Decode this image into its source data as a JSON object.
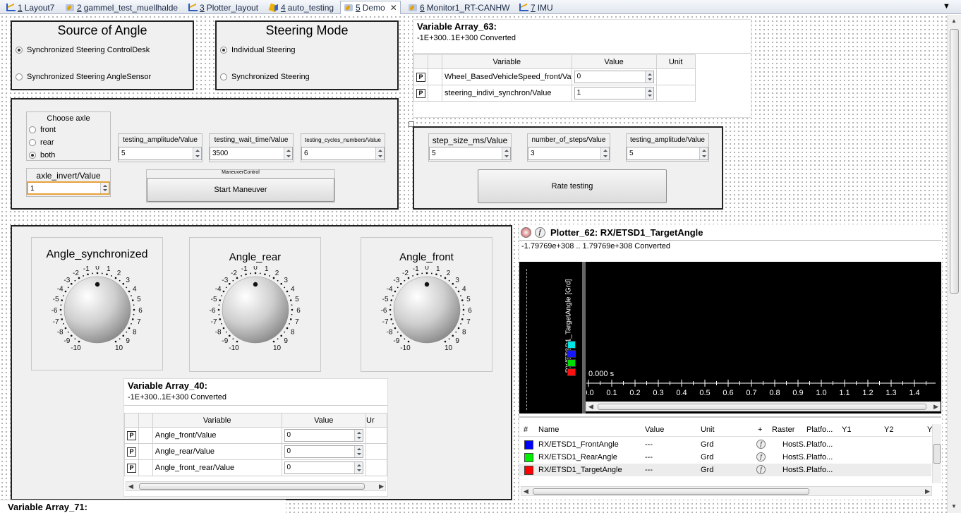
{
  "tabs": [
    {
      "num": "1",
      "label": "Layout7"
    },
    {
      "num": "2",
      "label": "gammel_test_muellhalde"
    },
    {
      "num": "3",
      "label": "Plotter_layout"
    },
    {
      "num": "4",
      "label": "auto_testing"
    },
    {
      "num": "5",
      "label": "Demo"
    },
    {
      "num": "6",
      "label": "Monitor1_RT-CANHW"
    },
    {
      "num": "7",
      "label": "IMU"
    }
  ],
  "source_of_angle": {
    "title": "Source of Angle",
    "options": [
      "Synchronized Steering ControlDesk",
      "Synchronized Steering AngleSensor"
    ],
    "selected": 0
  },
  "steering_mode": {
    "title": "Steering Mode",
    "options": [
      "Individual Steering",
      "Synchronized Steering"
    ],
    "selected": 0
  },
  "maneuver": {
    "choose_axle": {
      "title": "Choose axle",
      "options": [
        "front",
        "rear",
        "both"
      ],
      "selected": 2
    },
    "axle_invert": {
      "label": "axle_invert/Value",
      "value": "1"
    },
    "testing_amplitude": {
      "label": "testing_amplitude/Value",
      "value": "5"
    },
    "testing_wait_time": {
      "label": "testing_wait_time/Value",
      "value": "3500"
    },
    "testing_cycles_numbers": {
      "label": "testing_cycles_numbers/Value",
      "value": "6"
    },
    "group_caption": "ManeuverControl",
    "start_button": "Start Maneuver"
  },
  "rate": {
    "step_size": {
      "label": "step_size_ms/Value",
      "value": "5"
    },
    "number_of_steps": {
      "label": "number_of_steps/Value",
      "value": "3"
    },
    "testing_amplitude": {
      "label": "testing_amplitude/Value",
      "value": "5"
    },
    "button": "Rate testing"
  },
  "var_array_63": {
    "title": "Variable Array_63:",
    "subtitle": "-1E+300..1E+300 Converted",
    "headers": [
      "Variable",
      "Value",
      "Unit"
    ],
    "rows": [
      {
        "flag": "P",
        "variable": "Wheel_BasedVehicleSpeed_front/Va",
        "value": "0",
        "unit": ""
      },
      {
        "flag": "P",
        "variable": "steering_indivi_synchron/Value",
        "value": "1",
        "unit": ""
      }
    ]
  },
  "knobs": [
    {
      "title": "Angle_synchronized",
      "value": 0
    },
    {
      "title": "Angle_rear",
      "value": 0
    },
    {
      "title": "Angle_front",
      "value": 0
    }
  ],
  "knob_ticks": [
    "-10",
    "-9",
    "-8",
    "-7",
    "-6",
    "-5",
    "-4",
    "-3",
    "-2",
    "-1",
    "0",
    "1",
    "2",
    "3",
    "4",
    "5",
    "6",
    "7",
    "8",
    "9",
    "10"
  ],
  "var_array_40": {
    "title": "Variable Array_40:",
    "subtitle": "-1E+300..1E+300 Converted",
    "headers": [
      "Variable",
      "Value",
      "Ur"
    ],
    "rows": [
      {
        "flag": "P",
        "variable": "Angle_front/Value",
        "value": "0"
      },
      {
        "flag": "P",
        "variable": "Angle_rear/Value",
        "value": "0"
      },
      {
        "flag": "P",
        "variable": "Angle_front_rear/Value",
        "value": "0"
      }
    ]
  },
  "var_array_71": {
    "title": "Variable Array_71:"
  },
  "plotter": {
    "title": "Plotter_62:  RX/ETSD1_TargetAngle",
    "subtitle": "-1.79769e+308 .. 1.79769e+308  Converted",
    "y_axis_label": "RX/ETSD1_TargetAngle [Grd]",
    "time_label": "0.000 s",
    "x_ticks": [
      "0.0",
      "0.1",
      "0.2",
      "0.3",
      "0.4",
      "0.5",
      "0.6",
      "0.7",
      "0.8",
      "0.9",
      "1.0",
      "1.1",
      "1.2",
      "1.3",
      "1.4"
    ],
    "swatch_colors": [
      "#00e5e5",
      "#1818ff",
      "#00dd00",
      "#ff1010"
    ],
    "legend_headers": [
      "#",
      "Name",
      "Value",
      "Unit",
      "+",
      "Raster",
      "Platfo...",
      "Y1",
      "Y2",
      "Y"
    ],
    "legend_rows": [
      {
        "color": "#0000ff",
        "name": "RX/ETSD1_FrontAngle",
        "value": "---",
        "unit": "Grd",
        "raster": "HostS...",
        "platform": "Platfo..."
      },
      {
        "color": "#00ee00",
        "name": "RX/ETSD1_RearAngle",
        "value": "---",
        "unit": "Grd",
        "raster": "HostS...",
        "platform": "Platfo..."
      },
      {
        "color": "#ff0000",
        "name": "RX/ETSD1_TargetAngle",
        "value": "---",
        "unit": "Grd",
        "raster": "HostS...",
        "platform": "Platfo..."
      }
    ]
  }
}
